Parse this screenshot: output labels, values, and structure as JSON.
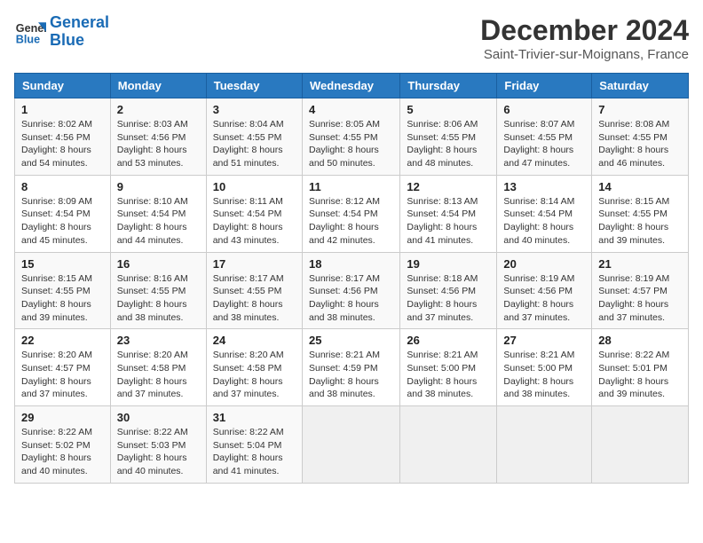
{
  "logo": {
    "line1": "General",
    "line2": "Blue"
  },
  "title": "December 2024",
  "location": "Saint-Trivier-sur-Moignans, France",
  "days_of_week": [
    "Sunday",
    "Monday",
    "Tuesday",
    "Wednesday",
    "Thursday",
    "Friday",
    "Saturday"
  ],
  "weeks": [
    [
      {
        "day": "1",
        "sunrise": "8:02 AM",
        "sunset": "4:56 PM",
        "daylight": "8 hours and 54 minutes."
      },
      {
        "day": "2",
        "sunrise": "8:03 AM",
        "sunset": "4:56 PM",
        "daylight": "8 hours and 53 minutes."
      },
      {
        "day": "3",
        "sunrise": "8:04 AM",
        "sunset": "4:55 PM",
        "daylight": "8 hours and 51 minutes."
      },
      {
        "day": "4",
        "sunrise": "8:05 AM",
        "sunset": "4:55 PM",
        "daylight": "8 hours and 50 minutes."
      },
      {
        "day": "5",
        "sunrise": "8:06 AM",
        "sunset": "4:55 PM",
        "daylight": "8 hours and 48 minutes."
      },
      {
        "day": "6",
        "sunrise": "8:07 AM",
        "sunset": "4:55 PM",
        "daylight": "8 hours and 47 minutes."
      },
      {
        "day": "7",
        "sunrise": "8:08 AM",
        "sunset": "4:55 PM",
        "daylight": "8 hours and 46 minutes."
      }
    ],
    [
      {
        "day": "8",
        "sunrise": "8:09 AM",
        "sunset": "4:54 PM",
        "daylight": "8 hours and 45 minutes."
      },
      {
        "day": "9",
        "sunrise": "8:10 AM",
        "sunset": "4:54 PM",
        "daylight": "8 hours and 44 minutes."
      },
      {
        "day": "10",
        "sunrise": "8:11 AM",
        "sunset": "4:54 PM",
        "daylight": "8 hours and 43 minutes."
      },
      {
        "day": "11",
        "sunrise": "8:12 AM",
        "sunset": "4:54 PM",
        "daylight": "8 hours and 42 minutes."
      },
      {
        "day": "12",
        "sunrise": "8:13 AM",
        "sunset": "4:54 PM",
        "daylight": "8 hours and 41 minutes."
      },
      {
        "day": "13",
        "sunrise": "8:14 AM",
        "sunset": "4:54 PM",
        "daylight": "8 hours and 40 minutes."
      },
      {
        "day": "14",
        "sunrise": "8:15 AM",
        "sunset": "4:55 PM",
        "daylight": "8 hours and 39 minutes."
      }
    ],
    [
      {
        "day": "15",
        "sunrise": "8:15 AM",
        "sunset": "4:55 PM",
        "daylight": "8 hours and 39 minutes."
      },
      {
        "day": "16",
        "sunrise": "8:16 AM",
        "sunset": "4:55 PM",
        "daylight": "8 hours and 38 minutes."
      },
      {
        "day": "17",
        "sunrise": "8:17 AM",
        "sunset": "4:55 PM",
        "daylight": "8 hours and 38 minutes."
      },
      {
        "day": "18",
        "sunrise": "8:17 AM",
        "sunset": "4:56 PM",
        "daylight": "8 hours and 38 minutes."
      },
      {
        "day": "19",
        "sunrise": "8:18 AM",
        "sunset": "4:56 PM",
        "daylight": "8 hours and 37 minutes."
      },
      {
        "day": "20",
        "sunrise": "8:19 AM",
        "sunset": "4:56 PM",
        "daylight": "8 hours and 37 minutes."
      },
      {
        "day": "21",
        "sunrise": "8:19 AM",
        "sunset": "4:57 PM",
        "daylight": "8 hours and 37 minutes."
      }
    ],
    [
      {
        "day": "22",
        "sunrise": "8:20 AM",
        "sunset": "4:57 PM",
        "daylight": "8 hours and 37 minutes."
      },
      {
        "day": "23",
        "sunrise": "8:20 AM",
        "sunset": "4:58 PM",
        "daylight": "8 hours and 37 minutes."
      },
      {
        "day": "24",
        "sunrise": "8:20 AM",
        "sunset": "4:58 PM",
        "daylight": "8 hours and 37 minutes."
      },
      {
        "day": "25",
        "sunrise": "8:21 AM",
        "sunset": "4:59 PM",
        "daylight": "8 hours and 38 minutes."
      },
      {
        "day": "26",
        "sunrise": "8:21 AM",
        "sunset": "5:00 PM",
        "daylight": "8 hours and 38 minutes."
      },
      {
        "day": "27",
        "sunrise": "8:21 AM",
        "sunset": "5:00 PM",
        "daylight": "8 hours and 38 minutes."
      },
      {
        "day": "28",
        "sunrise": "8:22 AM",
        "sunset": "5:01 PM",
        "daylight": "8 hours and 39 minutes."
      }
    ],
    [
      {
        "day": "29",
        "sunrise": "8:22 AM",
        "sunset": "5:02 PM",
        "daylight": "8 hours and 40 minutes."
      },
      {
        "day": "30",
        "sunrise": "8:22 AM",
        "sunset": "5:03 PM",
        "daylight": "8 hours and 40 minutes."
      },
      {
        "day": "31",
        "sunrise": "8:22 AM",
        "sunset": "5:04 PM",
        "daylight": "8 hours and 41 minutes."
      },
      null,
      null,
      null,
      null
    ]
  ]
}
